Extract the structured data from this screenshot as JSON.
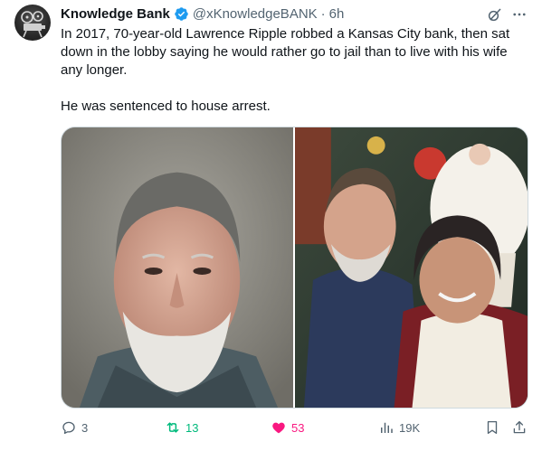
{
  "tweet": {
    "author": {
      "name": "Knowledge Bank",
      "handle": "@xKnowledgeBANK",
      "separator": "·",
      "time": "6h",
      "avatar_icon": "film-projector-icon",
      "verified_color": "#1d9bf0"
    },
    "text": {
      "paragraph_1": "In 2017, 70-year-old Lawrence Ripple robbed a Kansas City bank, then sat down in the lobby saying he would rather go to jail than to live with his wife any longer.",
      "paragraph_2": "He was sentenced to house arrest."
    },
    "media": [
      {
        "icon": "mugshot-photo",
        "description": "mugshot"
      },
      {
        "icon": "couple-photo",
        "description": "couple photo"
      }
    ],
    "actions": {
      "replies": "3",
      "retweets": "13",
      "likes": "53",
      "views": "19K"
    },
    "colors": {
      "text": "#0f1419",
      "secondary": "#536471",
      "retweet_active": "#00ba7c",
      "like_active": "#f91880"
    }
  }
}
